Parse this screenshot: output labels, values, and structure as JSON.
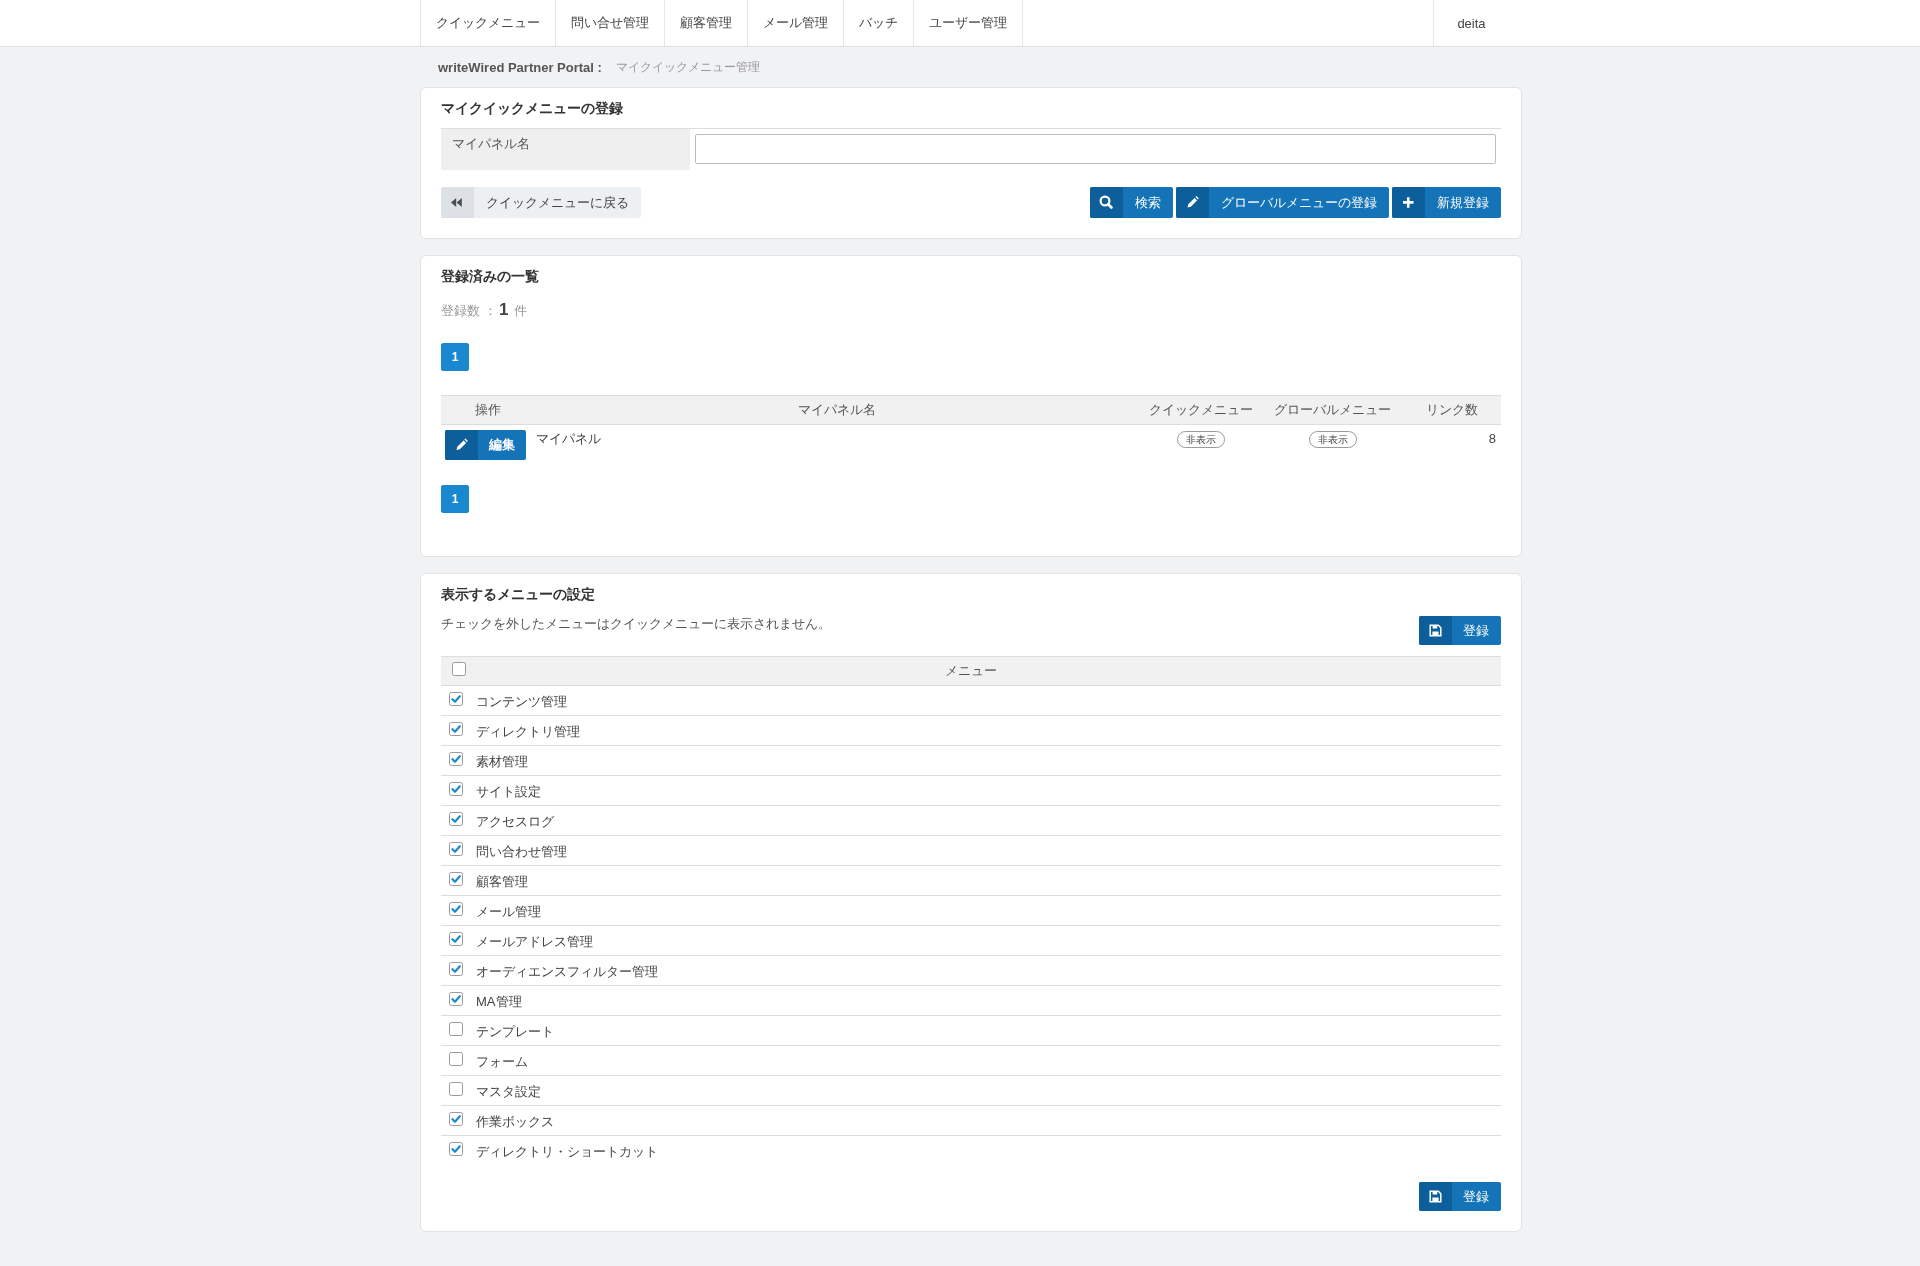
{
  "nav": {
    "items": [
      "クイックメニュー",
      "問い合せ管理",
      "顧客管理",
      "メール管理",
      "バッチ",
      "ユーザー管理"
    ],
    "user": "deita"
  },
  "breadcrumb": {
    "portal": "writeWired Partner Portal :",
    "page": "マイクイックメニュー管理"
  },
  "register_panel": {
    "title": "マイクイックメニューの登録",
    "field": {
      "label": "マイパネル名"
    },
    "back_button": "クイックメニューに戻る",
    "actions": [
      {
        "kind": "search",
        "label": "検索"
      },
      {
        "kind": "edit",
        "label": "グローバルメニューの登録"
      },
      {
        "kind": "add",
        "label": "新規登録"
      }
    ]
  },
  "list_panel": {
    "title": "登録済みの一覧",
    "count": {
      "label": "登録数",
      "separator": "：",
      "value": "1",
      "unit": "件"
    },
    "pages_top": [
      {
        "label": "1",
        "selected": true
      }
    ],
    "columns": [
      "操作",
      "マイパネル名",
      "クイックメニュー",
      "グローバルメニュー",
      "リンク数"
    ],
    "rows": [
      {
        "action": "編集",
        "name": "マイパネル",
        "quick_menu": "非表示",
        "global_menu": "非表示",
        "links": "8"
      }
    ],
    "pages_bottom": [
      {
        "label": "1",
        "selected": true
      }
    ]
  },
  "settings_panel": {
    "title": "表示するメニューの設定",
    "note": "チェックを外したメニューはクイックメニューに表示されません。",
    "save_button_top": "登録",
    "header": {
      "checked": false,
      "label": "メニュー"
    },
    "items": [
      {
        "label": "コンテンツ管理",
        "checked": true
      },
      {
        "label": "ディレクトリ管理",
        "checked": true
      },
      {
        "label": "素材管理",
        "checked": true
      },
      {
        "label": "サイト設定",
        "checked": true
      },
      {
        "label": "アクセスログ",
        "checked": true
      },
      {
        "label": "問い合わせ管理",
        "checked": true
      },
      {
        "label": "顧客管理",
        "checked": true
      },
      {
        "label": "メール管理",
        "checked": true
      },
      {
        "label": "メールアドレス管理",
        "checked": true
      },
      {
        "label": "オーディエンスフィルター管理",
        "checked": true
      },
      {
        "label": "MA管理",
        "checked": true
      },
      {
        "label": "テンプレート",
        "checked": false
      },
      {
        "label": "フォーム",
        "checked": false
      },
      {
        "label": "マスタ設定",
        "checked": false
      },
      {
        "label": "作業ボックス",
        "checked": true
      },
      {
        "label": "ディレクトリ・ショートカット",
        "checked": true
      }
    ],
    "save_button_bottom": "登録"
  }
}
